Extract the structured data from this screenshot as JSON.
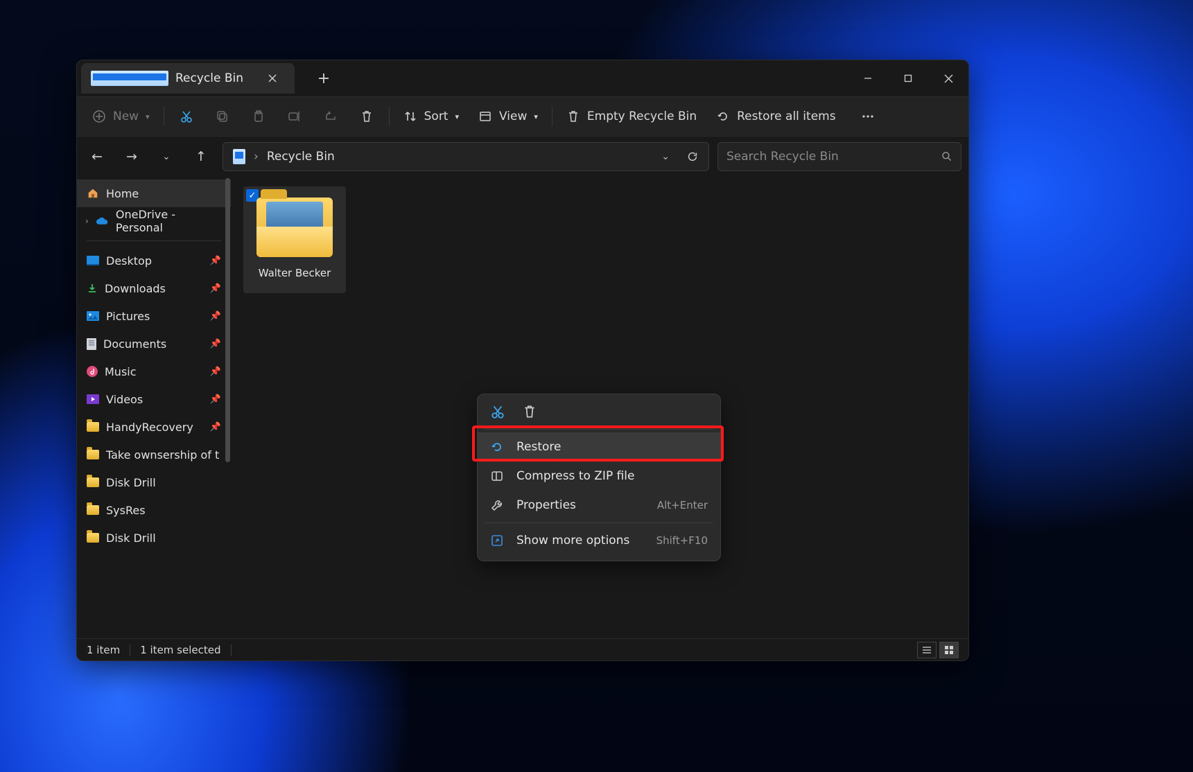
{
  "window": {
    "tab_title": "Recycle Bin"
  },
  "toolbar": {
    "new": "New",
    "sort": "Sort",
    "view": "View",
    "empty": "Empty Recycle Bin",
    "restore_all": "Restore all items"
  },
  "breadcrumb": {
    "path": "Recycle Bin"
  },
  "search": {
    "placeholder": "Search Recycle Bin"
  },
  "sidebar": {
    "home": "Home",
    "onedrive": "OneDrive - Personal",
    "quick": [
      {
        "label": "Desktop"
      },
      {
        "label": "Downloads"
      },
      {
        "label": "Pictures"
      },
      {
        "label": "Documents"
      },
      {
        "label": "Music"
      },
      {
        "label": "Videos"
      },
      {
        "label": "HandyRecovery"
      },
      {
        "label": "Take ownsership of t"
      },
      {
        "label": "Disk Drill"
      },
      {
        "label": "SysRes"
      },
      {
        "label": "Disk Drill"
      }
    ]
  },
  "content": {
    "items": [
      {
        "label": "Walter Becker"
      }
    ]
  },
  "context_menu": {
    "restore": "Restore",
    "compress": "Compress to ZIP file",
    "properties": "Properties",
    "properties_sc": "Alt+Enter",
    "more": "Show more options",
    "more_sc": "Shift+F10"
  },
  "status": {
    "count": "1 item",
    "selected": "1 item selected"
  }
}
